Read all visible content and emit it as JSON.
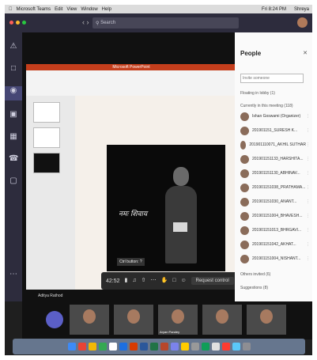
{
  "menubar": {
    "app": "Microsoft Teams",
    "items": [
      "Edit",
      "View",
      "Window",
      "Help"
    ],
    "status": "Fri 8:24 PM",
    "user": "Shreya"
  },
  "toolbar": {
    "search_placeholder": "Search"
  },
  "rail": {
    "items": [
      "Activity",
      "Chat",
      "Teams",
      "Assignments",
      "Calendar",
      "Calls",
      "Files"
    ]
  },
  "ppt": {
    "title": "Microsoft PowerPoint",
    "slide_text": "नमः शिवाय"
  },
  "stage": {
    "presenter_label": "Aditya Rathod",
    "tooltip": "Ctrl button: ?"
  },
  "callbar": {
    "time": "42:52",
    "request_control": "Request control"
  },
  "people": {
    "title": "People",
    "invite_placeholder": "Invite someone",
    "floating_label": "Floating in lobby (1)",
    "in_meeting_label": "Currently in this meeting (118)",
    "others_label": "Others invited (6)",
    "suggestions_label": "Suggestions (8)",
    "participants": [
      "Ishan Goswami (Organizer)",
      "201901151_SURESH K...",
      "201901110071_AKHIL SUTHAR",
      "201901151133_HARSHITA...",
      "201901151130_ABHINAV...",
      "201901151038_PRATHAMA...",
      "201901151030_ANANT...",
      "201901151004_BHAVESH...",
      "201901151013_BHRGAVI...",
      "201901151042_AKHAT...",
      "201901151004_NISHANT..."
    ]
  },
  "tiles": {
    "names": [
      "",
      "",
      "",
      "Aryan Pandey",
      "",
      ""
    ]
  },
  "colors": {
    "teams_purple": "#464775",
    "hangup_red": "#c4314b",
    "ppt_orange": "#c43e1c"
  }
}
